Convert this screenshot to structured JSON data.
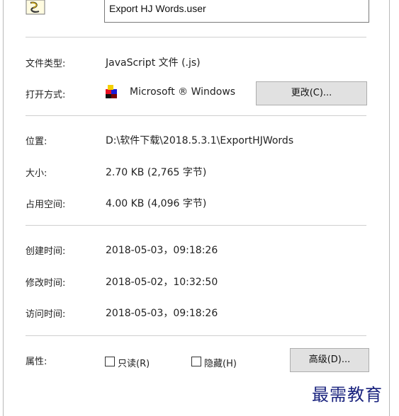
{
  "file": {
    "icon": "javascript-file-icon",
    "name": "Export HJ Words.user"
  },
  "general": {
    "type_label": "文件类型:",
    "type_value": "JavaScript 文件 (.js)",
    "opens_with_label": "打开方式:",
    "opens_with_icon": "windows-app-icon",
    "opens_with_value": "Microsoft ® Windows",
    "change_button": "更改(C)..."
  },
  "location": {
    "location_label": "位置:",
    "location_value": "D:\\软件下载\\2018.5.3.1\\ExportHJWords",
    "size_label": "大小:",
    "size_value": "2.70 KB (2,765 字节)",
    "disk_label": "占用空间:",
    "disk_value": "4.00 KB (4,096 字节)"
  },
  "dates": {
    "created_label": "创建时间:",
    "created_value": "2018-05-03，09:18:26",
    "modified_label": "修改时间:",
    "modified_value": "2018-05-02，10:32:50",
    "accessed_label": "访问时间:",
    "accessed_value": "2018-05-03，09:18:26"
  },
  "attributes": {
    "label": "属性:",
    "readonly_label": "只读(R)",
    "readonly_checked": false,
    "hidden_label": "隐藏(H)",
    "hidden_checked": false,
    "advanced_button": "高级(D)..."
  },
  "watermark": "最需教育"
}
